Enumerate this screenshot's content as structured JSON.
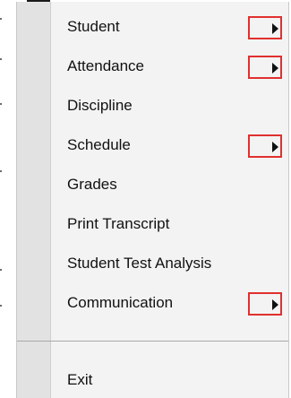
{
  "menu": {
    "items": [
      {
        "label": "Student",
        "has_submenu": true
      },
      {
        "label": "Attendance",
        "has_submenu": true
      },
      {
        "label": "Discipline",
        "has_submenu": false
      },
      {
        "label": "Schedule",
        "has_submenu": true
      },
      {
        "label": "Grades",
        "has_submenu": false
      },
      {
        "label": "Print Transcript",
        "has_submenu": false
      },
      {
        "label": "Student Test Analysis",
        "has_submenu": false
      },
      {
        "label": "Communication",
        "has_submenu": true
      }
    ],
    "exit_label": "Exit",
    "submenu_icon": "triangle-right-icon",
    "highlight_color": "#e0302f"
  }
}
